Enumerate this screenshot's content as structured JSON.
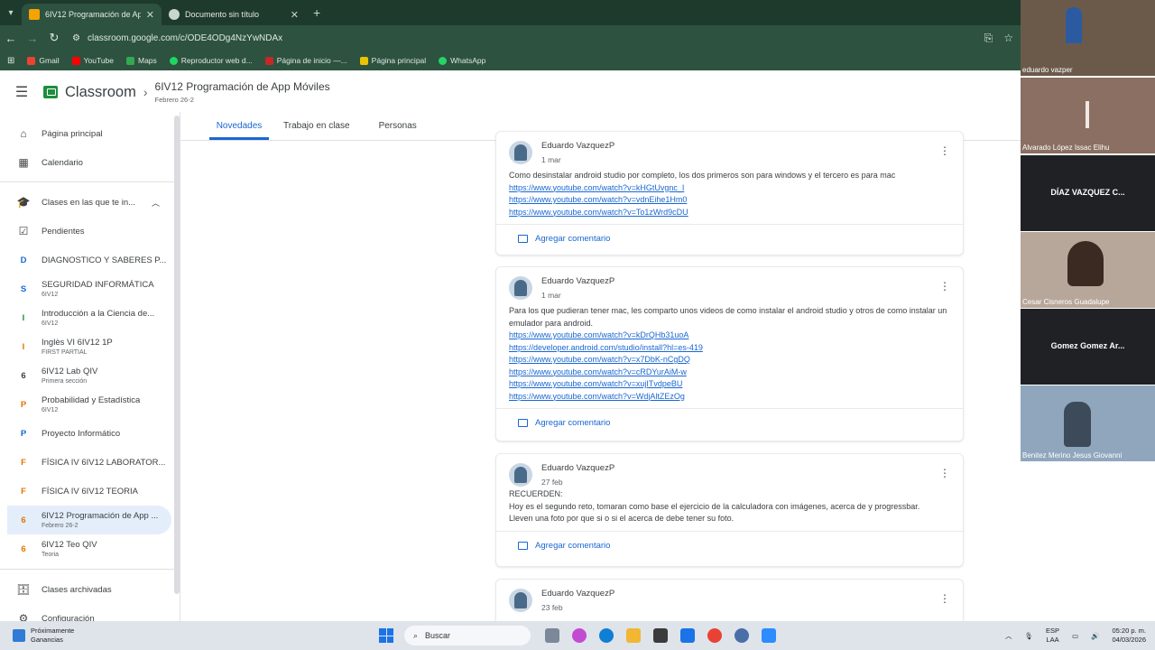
{
  "browser": {
    "tabs": [
      {
        "title": "6IV12 Programación de App Mó",
        "active": true
      },
      {
        "title": "Documento sin título",
        "active": false
      }
    ],
    "url": "classroom.google.com/c/ODE4ODg4NzYwNDAx",
    "bookmarks": [
      "Gmail",
      "YouTube",
      "Maps",
      "Reproductor web d...",
      "Página de inicio —...",
      "Página principal",
      "WhatsApp"
    ]
  },
  "header": {
    "brand": "Classroom",
    "course_title": "6IV12 Programación de App Móviles",
    "course_sub": "Febrero 26-2"
  },
  "course_tabs": [
    "Novedades",
    "Trabajo en clase",
    "Personas"
  ],
  "sidebar": {
    "top": [
      {
        "label": "Página principal",
        "icon": "home-icon"
      },
      {
        "label": "Calendario",
        "icon": "calendar-icon"
      }
    ],
    "section": "Clases en las que te in...",
    "pending": "Pendientes",
    "classes": [
      {
        "letter": "D",
        "label": "DIAGNOSTICO Y SABERES P...",
        "sub": "",
        "color": "#1967d2"
      },
      {
        "letter": "S",
        "label": "SEGURIDAD INFORMÁTICA",
        "sub": "6IV12",
        "color": "#1967d2"
      },
      {
        "letter": "I",
        "label": "Introducción a la Ciencia de...",
        "sub": "6IV12",
        "color": "#1e8e3e"
      },
      {
        "letter": "I",
        "label": "Inglès VI 6IV12 1P",
        "sub": "FIRST PARTIAL",
        "color": "#e37400"
      },
      {
        "letter": "6",
        "label": "6IV12 Lab QIV",
        "sub": "Primera sección",
        "color": "#3c4043"
      },
      {
        "letter": "P",
        "label": "Probabilidad y Estadística",
        "sub": "6IV12",
        "color": "#e37400"
      },
      {
        "letter": "P",
        "label": "Proyecto Informático",
        "sub": "",
        "color": "#1967d2"
      },
      {
        "letter": "F",
        "label": "FÍSICA IV 6IV12 LABORATOR...",
        "sub": "",
        "color": "#e37400"
      },
      {
        "letter": "F",
        "label": "FÍSICA IV 6IV12 TEORIA",
        "sub": "",
        "color": "#e37400"
      },
      {
        "letter": "6",
        "label": "6IV12 Programación de App ...",
        "sub": "Febrero 26-2",
        "color": "#e37400",
        "active": true
      },
      {
        "letter": "6",
        "label": "6IV12 Teo QIV",
        "sub": "Teoria",
        "color": "#e37400"
      }
    ],
    "archived": "Clases archivadas",
    "settings": "Configuración"
  },
  "posts": [
    {
      "author": "Eduardo VazquezP",
      "date": "1 mar",
      "text": "Como desinstalar android studio por completo, los dos primeros son para windows y el tercero es para mac",
      "links": [
        "https://www.youtube.com/watch?v=kHGtUvgnc_I",
        "https://www.youtube.com/watch?v=vdnEihe1Hm0",
        "https://www.youtube.com/watch?v=To1zWrd9cDU"
      ],
      "comment": "Agregar comentario"
    },
    {
      "author": "Eduardo VazquezP",
      "date": "1 mar",
      "text": "Para los que pudieran tener mac, les comparto unos videos de como instalar el android studio y otros de como instalar un emulador para android.",
      "links": [
        "https://www.youtube.com/watch?v=kDrQHb31uoA",
        "https://developer.android.com/studio/install?hl=es-419",
        "https://www.youtube.com/watch?v=x7DbK-nCgDQ",
        "https://www.youtube.com/watch?v=cRDYurAiM-w",
        "https://www.youtube.com/watch?v=xujITvdpeBU",
        "https://www.youtube.com/watch?v=WdjAltZEzOg"
      ],
      "comment": "Agregar comentario"
    },
    {
      "author": "Eduardo VazquezP",
      "date": "27 feb",
      "text_lines": [
        "RECUERDEN:",
        "Hoy es el segundo reto, tomaran como base el ejercicio de la calculadora con imágenes, acerca de y progressbar.",
        "Lleven una foto por que si o si el acerca de debe tener su foto."
      ],
      "comment": "Agregar comentario"
    },
    {
      "author": "Eduardo VazquezP",
      "date": "23 feb"
    }
  ],
  "participants": [
    {
      "name": "eduardo vazper",
      "video": true
    },
    {
      "name": "Alvarado López Issac Elihu",
      "video": true
    },
    {
      "name": "DÍAZ VAZQUEZ C...",
      "video": false
    },
    {
      "name": "Cesar Cisneros Guadalupe",
      "video": true
    },
    {
      "name": "Gomez Gomez Ar...",
      "video": false
    },
    {
      "name": "Benitez Merino Jesus Giovanni",
      "video": true
    }
  ],
  "taskbar": {
    "weather_title": "Próximamente",
    "weather_sub": "Ganancias",
    "search": "Buscar",
    "lang": "ESP",
    "lang_sub": "LAA",
    "time": "05:20 p. m.",
    "date": "04/03/2026"
  }
}
